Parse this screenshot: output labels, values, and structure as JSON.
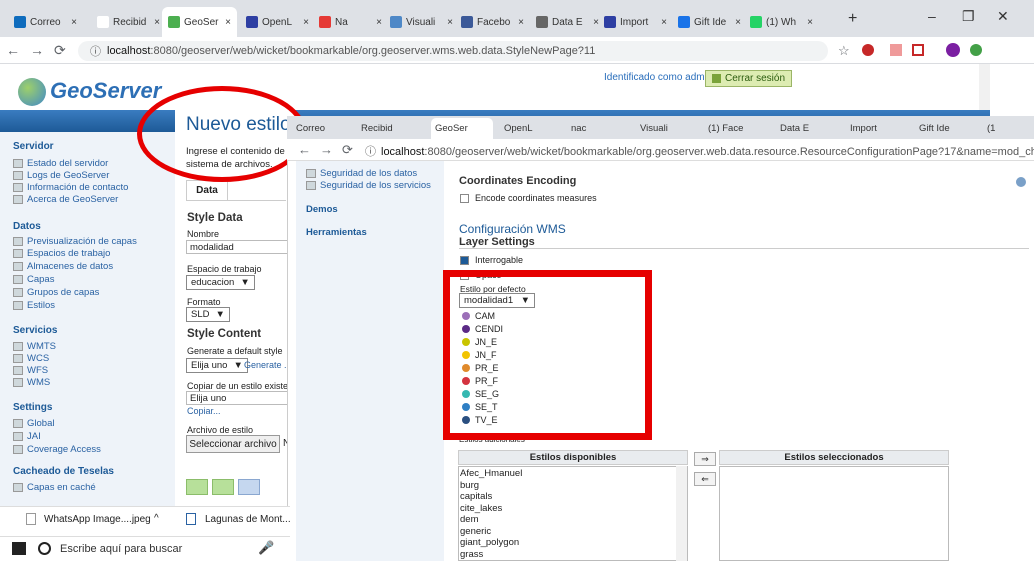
{
  "browser": {
    "tabs": [
      {
        "label": "Correo",
        "color": "#0f6cbd"
      },
      {
        "label": "Recibid",
        "color": "#ffffff"
      },
      {
        "label": "GeoSer",
        "color": "#4caf50"
      },
      {
        "label": "OpenL",
        "color": "#2e3fa3"
      },
      {
        "label": "Na",
        "color": "#e53935"
      },
      {
        "label": "Visuali",
        "color": "#4e88c7"
      },
      {
        "label": "Facebo",
        "color": "#3b5998"
      },
      {
        "label": "Data E",
        "color": "#666666"
      },
      {
        "label": "Import",
        "color": "#2e3fa3"
      },
      {
        "label": "Gift Ide",
        "color": "#1a73e8"
      },
      {
        "label": "(1) Wh",
        "color": "#25d366"
      }
    ],
    "url_host": "localhost",
    "url_rest": ":8080/geoserver/web/wicket/bookmarkable/org.geoserver.wms.web.data.StyleNewPage?11"
  },
  "header": {
    "logo": "GeoServer",
    "user_text": "Identificado como admin.",
    "logout": "Cerrar sesión"
  },
  "sidebar": {
    "servidor": {
      "title": "Servidor",
      "items": [
        "Estado del servidor",
        "Logs de GeoServer",
        "Información de contacto",
        "Acerca de GeoServer"
      ]
    },
    "datos": {
      "title": "Datos",
      "items": [
        "Previsualización de capas",
        "Espacios de trabajo",
        "Almacenes de datos",
        "Capas",
        "Grupos de capas",
        "Estilos"
      ]
    },
    "servicios": {
      "title": "Servicios",
      "items": [
        "WMTS",
        "WCS",
        "WFS",
        "WMS"
      ]
    },
    "settings": {
      "title": "Settings",
      "items": [
        "Global",
        "JAI",
        "Coverage Access"
      ]
    },
    "cacheado": {
      "title": "Cacheado de Teselas",
      "items": [
        "Capas en caché"
      ]
    }
  },
  "style_page": {
    "title": "Nuevo estilo",
    "intro": "Ingrese el contenido de un",
    "intro2": "sistema de archivos.",
    "tab": "Data",
    "style_data": "Style Data",
    "nombre_label": "Nombre",
    "nombre_value": "modalidad",
    "workspace_label": "Espacio de trabajo",
    "workspace_value": "educacion",
    "format_label": "Formato",
    "format_value": "SLD",
    "style_content": "Style Content",
    "generate_label": "Generate a default style",
    "generate_value": "Elija uno",
    "generate_link": "Generate ...",
    "copy_label": "Copiar de un estilo existente",
    "copy_value": "Elija uno",
    "copy_link": "Copiar...",
    "file_label": "Archivo de estilo",
    "file_button": "Seleccionar archivo",
    "file_after": "N"
  },
  "overlay": {
    "tabs": [
      "Correo",
      "Recibid",
      "GeoSer",
      "OpenL",
      "nac",
      "Visuali",
      "(1) Face",
      "Data E",
      "Import",
      "Gift Ide",
      "(1"
    ],
    "url_host": "localhost",
    "url_rest": ":8080/geoserver/web/wicket/bookmarkable/org.geoserver.web.data.resource.ResourceConfigurationPage?17&name=mod_chilpa&wsName=ed",
    "side_links": [
      "Seguridad de los datos",
      "Seguridad de los servicios"
    ],
    "side_sections": [
      "Demos",
      "Herramientas"
    ],
    "coord_title": "Coordinates Encoding",
    "coord_check": "Encode coordinates measures",
    "wms_title": "Configuración WMS",
    "layer_settings": "Layer Settings",
    "queryable": "Interrogable",
    "opaque": "Opaco",
    "default_style_label": "Estilo por defecto",
    "default_style_value": "modalidad1",
    "legend": [
      {
        "label": "CAM",
        "color": "#9c6fb8"
      },
      {
        "label": "CENDI",
        "color": "#5b2a86"
      },
      {
        "label": "JN_E",
        "color": "#c9c400"
      },
      {
        "label": "JN_F",
        "color": "#f2c400"
      },
      {
        "label": "PR_E",
        "color": "#e08a2b"
      },
      {
        "label": "PR_F",
        "color": "#d4333f"
      },
      {
        "label": "SE_G",
        "color": "#35b8b1"
      },
      {
        "label": "SE_T",
        "color": "#2f7fc4"
      },
      {
        "label": "TV_E",
        "color": "#2a4f80"
      }
    ],
    "additional_styles": "Estilos adicionales",
    "available_header": "Estilos disponibles",
    "selected_header": "Estilos seleccionados",
    "available": [
      "Afec_Hmanuel",
      "burg",
      "capitals",
      "cite_lakes",
      "dem",
      "generic",
      "giant_polygon",
      "grass"
    ],
    "move_right": "⇒",
    "move_left": "⇐"
  },
  "downloads": {
    "item1": "WhatsApp Image....jpeg",
    "item2": "Lagunas de Mont..."
  },
  "taskbar": {
    "search": "Escribe aquí para buscar"
  },
  "colors": {
    "accent": "#1d5a97",
    "highlight": "#e60000"
  }
}
